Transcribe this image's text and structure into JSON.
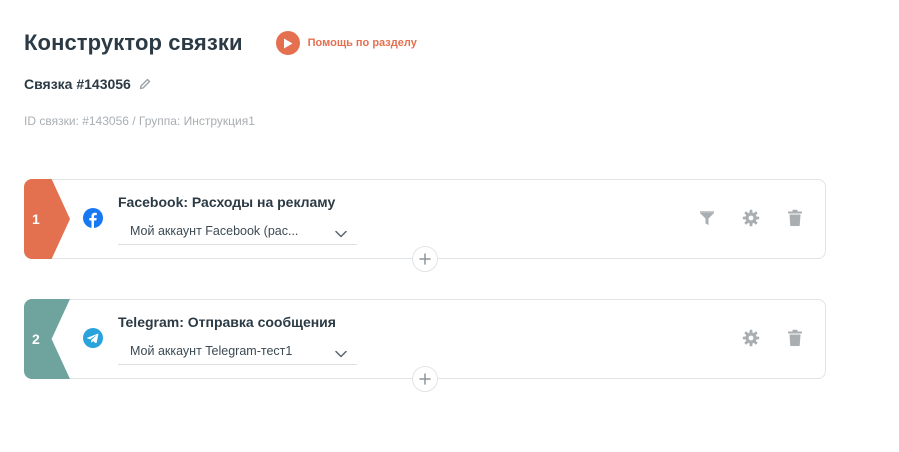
{
  "header": {
    "title": "Конструктор связки",
    "help_label": "Помощь по разделу",
    "accent_color": "#e4704f"
  },
  "link": {
    "name": "Связка #143056",
    "meta": "ID связки: #143056 / Группа: Инструкция1"
  },
  "steps": [
    {
      "number": "1",
      "title": "Facebook: Расходы на рекламу",
      "account": "Мой аккаунт Facebook (рас...",
      "service_icon": "facebook-icon",
      "tab_color": "#e3704f",
      "actions": [
        "filter-icon",
        "gear-icon",
        "trash-icon"
      ]
    },
    {
      "number": "2",
      "title": "Telegram: Отправка сообщения",
      "account": "Мой аккаунт Telegram-тест1",
      "service_icon": "telegram-icon",
      "tab_color": "#6fa49e",
      "actions": [
        "gear-icon",
        "trash-icon"
      ]
    }
  ]
}
